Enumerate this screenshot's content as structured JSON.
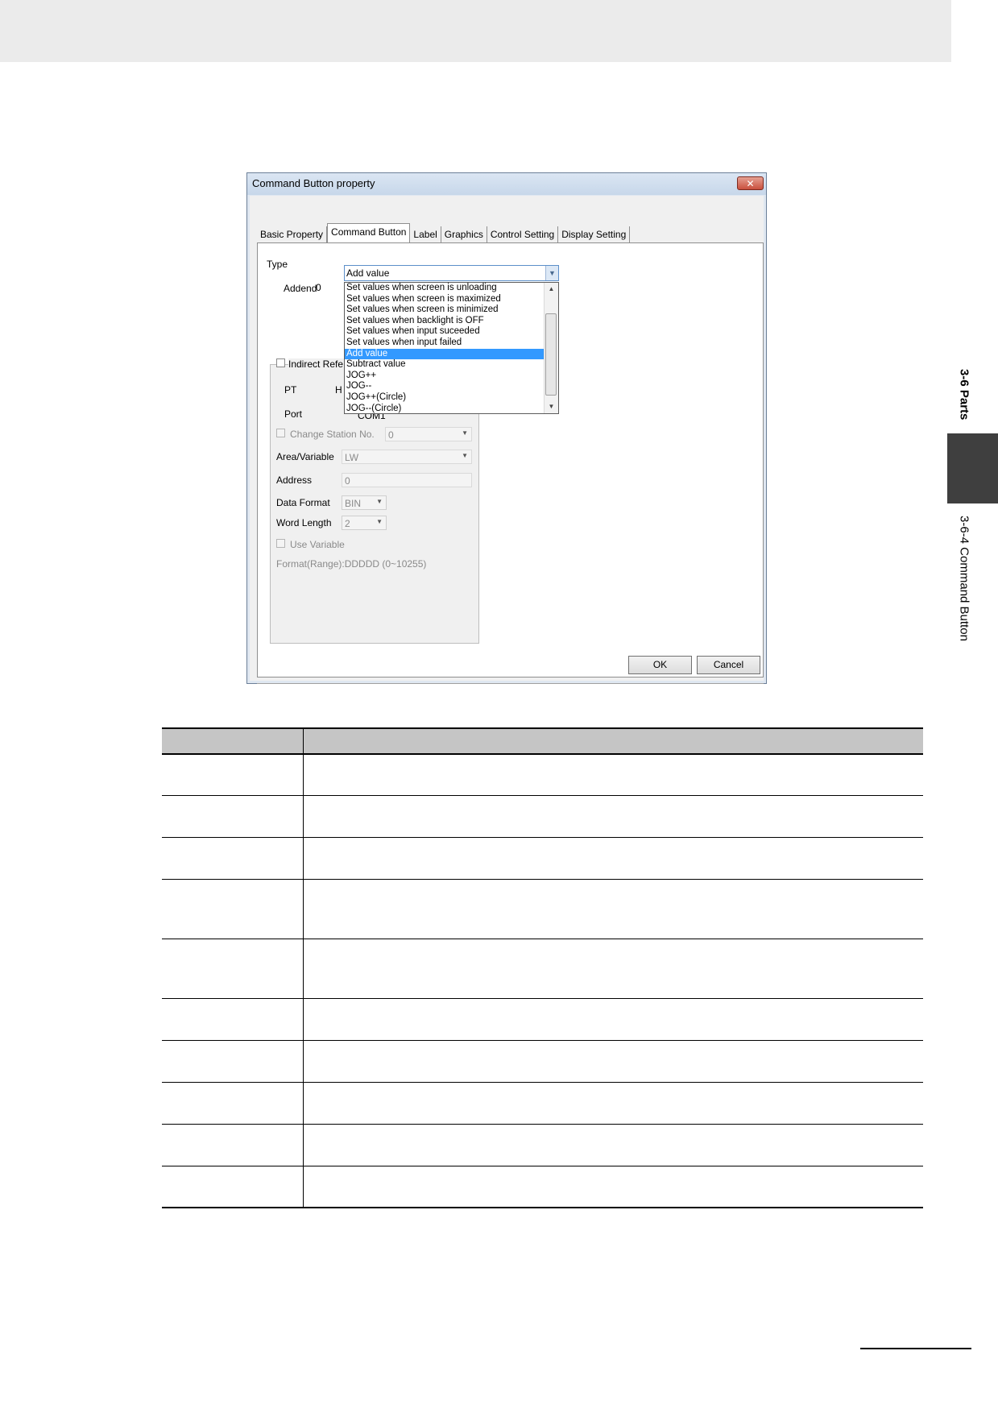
{
  "side_index": {
    "section": "3-6 Parts",
    "subsection": "3-6-4  Command Button"
  },
  "dialog": {
    "title": "Command Button property",
    "close_glyph": "✕",
    "tabs": [
      "Basic Property",
      "Command Button",
      "Label",
      "Graphics",
      "Control Setting",
      "Display Setting"
    ],
    "active_tab": "Command Button",
    "type_label": "Type",
    "type_value": "Add value",
    "addend_label": "Addend",
    "addend_value": "0",
    "type_options": [
      "Set values when screen is unloading",
      "Set values when screen is maximized",
      "Set values when screen is minimized",
      "Set values when backlight is OFF",
      "Set values when input suceeded",
      "Set values when input failed",
      "Add value",
      "Subtract value",
      "JOG++",
      "JOG--",
      "JOG++(Circle)",
      "JOG--(Circle)"
    ],
    "selected_option": "Add value",
    "indirect_ref_label": "Indirect Refe",
    "pt_label": "PT",
    "pt_value_partial": "H",
    "port_label": "Port",
    "port_value": "COM1",
    "change_station_label": "Change Station No.",
    "change_station_value": "0",
    "area_label": "Area/Variable",
    "area_value": "LW",
    "address_label": "Address",
    "address_value": "0",
    "data_format_label": "Data Format",
    "data_format_value": "BIN",
    "word_length_label": "Word Length",
    "word_length_value": "2",
    "use_variable_label": "Use Variable",
    "format_range": "Format(Range):DDDDD (0~10255)",
    "ok_label": "OK",
    "cancel_label": "Cancel"
  },
  "table": {
    "header": [
      "",
      ""
    ],
    "rows": [
      [
        "",
        ""
      ],
      [
        "",
        ""
      ],
      [
        "",
        ""
      ],
      [
        "",
        ""
      ],
      [
        "",
        ""
      ],
      [
        "",
        ""
      ],
      [
        "",
        ""
      ],
      [
        "",
        ""
      ],
      [
        "",
        ""
      ],
      [
        "",
        ""
      ]
    ]
  }
}
